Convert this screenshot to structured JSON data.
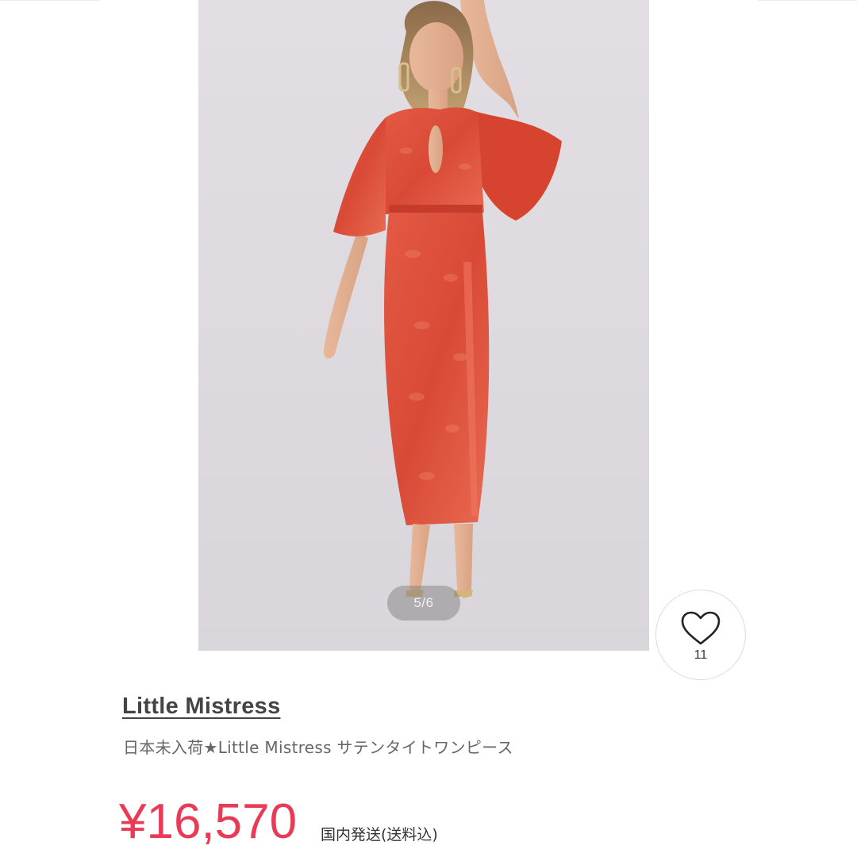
{
  "gallery": {
    "page_indicator": "5/6",
    "image_subject": "model wearing red satin midi dress with flutter sleeves"
  },
  "like": {
    "icon": "heart-icon",
    "count": "11"
  },
  "product": {
    "brand": "Little Mistress",
    "title": "日本未入荷★Little Mistress サテンタイトワンピース",
    "price": "¥16,570",
    "shipping_note": "国内発送(送料込)"
  },
  "colors": {
    "price": "#ea3b56",
    "dress": "#e0553f",
    "background": "#ddd9de"
  }
}
